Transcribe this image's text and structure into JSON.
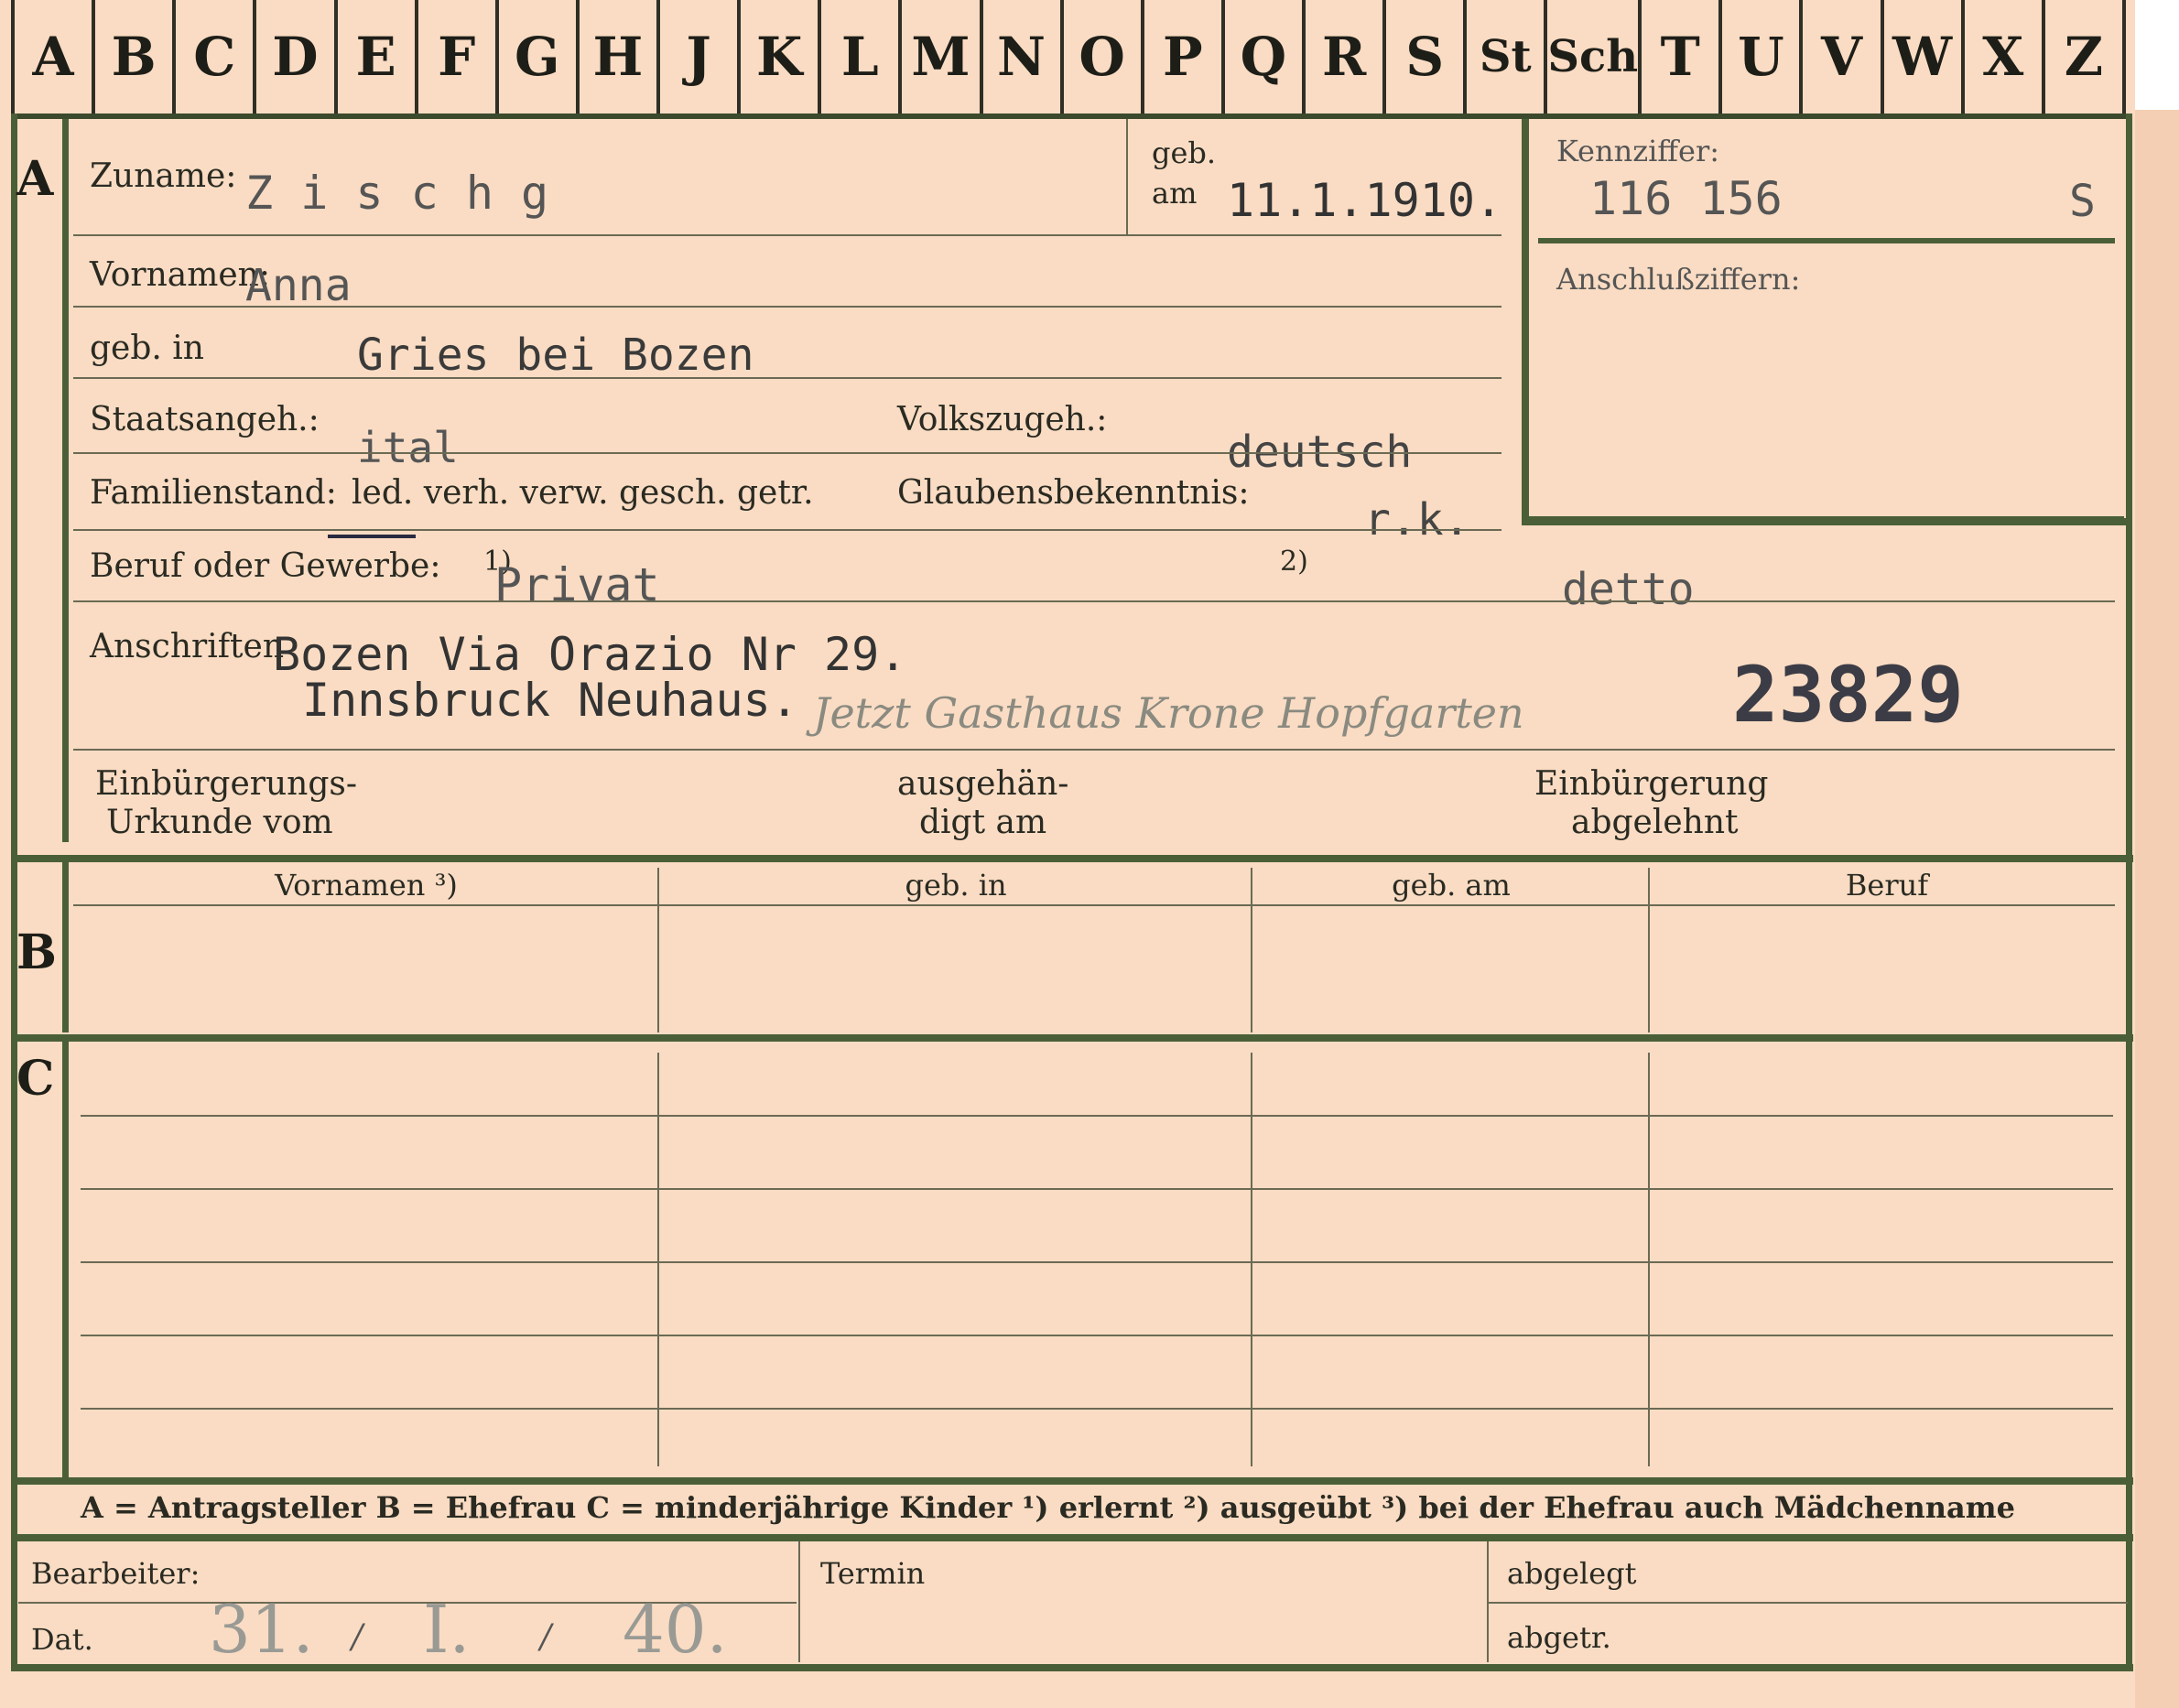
{
  "alphabet_tabs": [
    "A",
    "B",
    "C",
    "D",
    "E",
    "F",
    "G",
    "H",
    "J",
    "K",
    "L",
    "M",
    "N",
    "O",
    "P",
    "Q",
    "R",
    "S",
    "St",
    "Sch",
    "T",
    "U",
    "V",
    "W",
    "X",
    "Z"
  ],
  "section_a": {
    "letter": "A",
    "surname_label": "Zuname:",
    "surname_value": "Z i s c h g",
    "born_label_top": "geb.",
    "born_label_bottom": "am",
    "born_date": "11.1.1910.",
    "id_label": "Kennziffer:",
    "id_number": "116 156",
    "id_suffix": "S",
    "linked_label": "Anschlußziffern:",
    "firstnames_label": "Vornamen:",
    "firstnames_value": "Anna",
    "birthplace_label": "geb. in",
    "birthplace_value": "Gries bei Bozen",
    "citizenship_label": "Staatsangeh.:",
    "citizenship_value": "ital",
    "ethnicity_label": "Volkszugeh.:",
    "ethnicity_value": "deutsch",
    "marital_label": "Familienstand:",
    "marital_options": "led. verh. verw. gesch. getr.",
    "religion_label": "Glaubensbekenntnis:",
    "religion_value": "r.k.",
    "occupation_label": "Beruf oder Gewerbe:",
    "occupation_mark1": "1)",
    "occupation_value": "Privat",
    "occupation_mark2": "2)",
    "occupation_value2": "detto",
    "address_label": "Anschriften",
    "address_line1": "Bozen Via Orazio Nr 29.",
    "address_line2": "Innsbruck Neuhaus.",
    "address_handwritten": "Jetzt Gasthaus Krone Hopfgarten",
    "file_number": "23829",
    "naturalization_label_1": "Einbürgerungs-",
    "naturalization_label_2": "Urkunde vom",
    "issued_label_1": "ausgehän-",
    "issued_label_2": "digt am",
    "rejected_label_1": "Einbürgerung",
    "rejected_label_2": "abgelehnt"
  },
  "section_b": {
    "letter": "B",
    "columns": [
      "Vornamen ³)",
      "geb. in",
      "geb. am",
      "Beruf"
    ]
  },
  "section_c": {
    "letter": "C"
  },
  "legend": "A = Antragsteller   B = Ehefrau   C = minderjährige Kinder   ¹) erlernt   ²) ausgeübt   ³) bei der Ehefrau auch Mädchenname",
  "footer": {
    "processor_label": "Bearbeiter:",
    "date_label": "Dat.",
    "date_day": "31.",
    "date_month": "I.",
    "date_year": "40.",
    "date_sep": "/",
    "deadline_label": "Termin",
    "filed_label": "abgelegt",
    "sent_label": "abgetr."
  },
  "colors": {
    "card": "#f9dcc3",
    "green_border": "#4a5f38",
    "ink_typed": "#3a3a3a",
    "ink_pencil": "#8a8a80"
  }
}
